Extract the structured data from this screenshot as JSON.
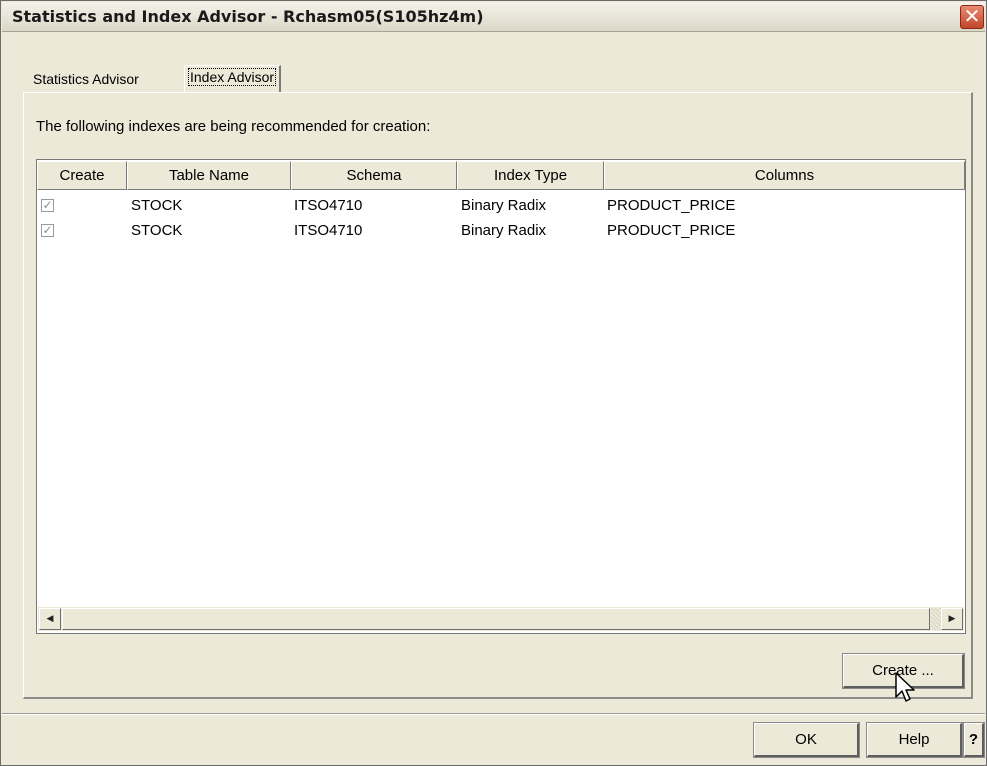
{
  "window": {
    "title": "Statistics and Index Advisor - Rchasm05(S105hz4m)",
    "close_glyph": "✕"
  },
  "tabs": [
    {
      "label": "Statistics Advisor",
      "active": false
    },
    {
      "label": "Index Advisor",
      "active": true
    }
  ],
  "intro_text": "The following indexes are being recommended for creation:",
  "table": {
    "headers": [
      "Create",
      "Table Name",
      "Schema",
      "Index Type",
      "Columns"
    ],
    "rows": [
      {
        "create": true,
        "table_name": "STOCK",
        "schema": "ITSO4710",
        "index_type": "Binary Radix",
        "columns": "PRODUCT_PRICE"
      },
      {
        "create": true,
        "table_name": "STOCK",
        "schema": "ITSO4710",
        "index_type": "Binary Radix",
        "columns": "PRODUCT_PRICE"
      }
    ]
  },
  "scrollbar": {
    "left_arrow": "◀",
    "right_arrow": "▶"
  },
  "buttons": {
    "create": "Create ...",
    "ok": "OK",
    "help": "Help",
    "question": "?"
  },
  "icons": {
    "close": "close-icon",
    "checkbox": "checkmark-icon",
    "cursor": "mouse-pointer-icon"
  }
}
